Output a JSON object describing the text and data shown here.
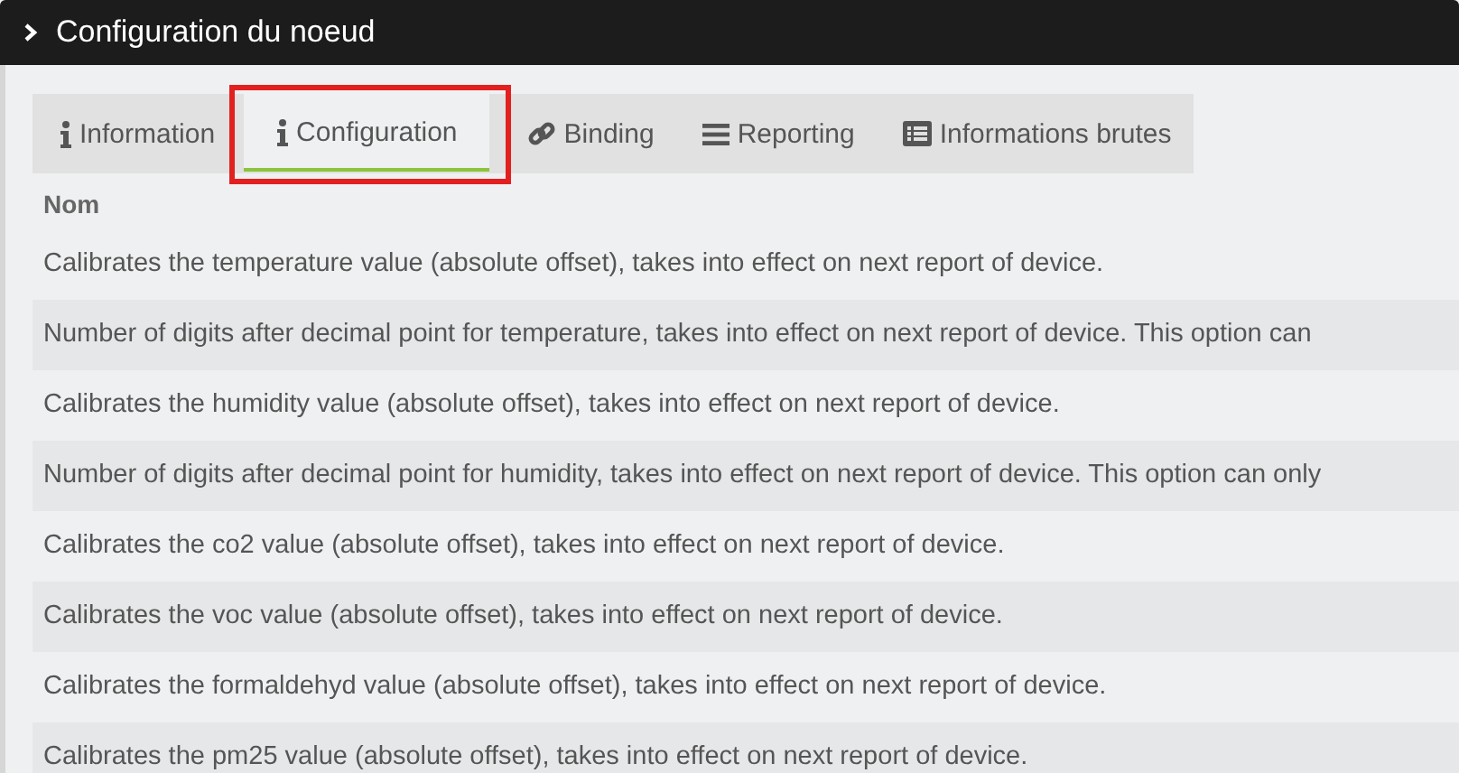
{
  "panel": {
    "title": "Configuration du noeud"
  },
  "tabs": [
    {
      "label": "Information",
      "kind": "info",
      "selected": false
    },
    {
      "label": "Configuration",
      "kind": "info",
      "selected": true
    },
    {
      "label": "Binding",
      "kind": "link",
      "selected": false
    },
    {
      "label": "Reporting",
      "kind": "bars",
      "selected": false
    },
    {
      "label": "Informations brutes",
      "kind": "list",
      "selected": false
    }
  ],
  "table": {
    "columns": [
      "Nom"
    ],
    "rows": [
      "Calibrates the temperature value (absolute offset), takes into effect on next report of device.",
      "Number of digits after decimal point for temperature, takes into effect on next report of device. This option can",
      "Calibrates the humidity value (absolute offset), takes into effect on next report of device.",
      "Number of digits after decimal point for humidity, takes into effect on next report of device. This option can only",
      "Calibrates the co2 value (absolute offset), takes into effect on next report of device.",
      "Calibrates the voc value (absolute offset), takes into effect on next report of device.",
      "Calibrates the formaldehyd value (absolute offset), takes into effect on next report of device.",
      "Calibrates the pm25 value (absolute offset), takes into effect on next report of device."
    ]
  }
}
